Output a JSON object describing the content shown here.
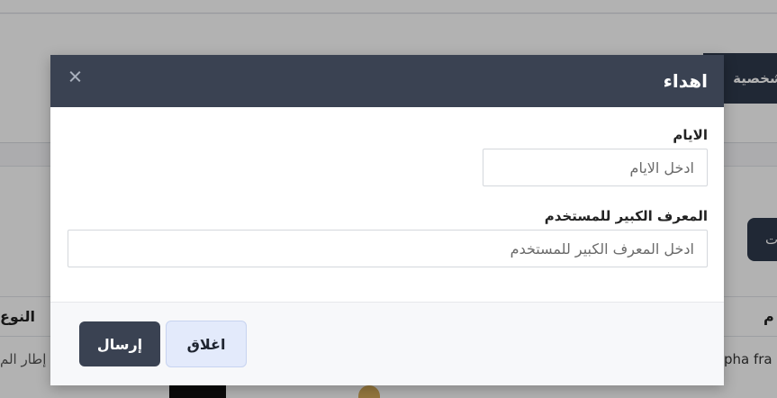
{
  "background": {
    "tab_label": "الشخصية",
    "action_button_label": "ت",
    "table_headers": {
      "name": "م",
      "type": "النوع"
    },
    "table_row": {
      "name": "pha fra",
      "frame": "إطار الم"
    }
  },
  "modal": {
    "title": "اهداء",
    "days": {
      "label": "الايام",
      "placeholder": "ادخل الايام",
      "value": ""
    },
    "uuid": {
      "label": "المعرف الكبير للمستخدم",
      "placeholder": "ادخل المعرف الكبير للمستخدم",
      "value": ""
    },
    "buttons": {
      "submit": "إرسال",
      "close": "اغلاق"
    }
  },
  "colors": {
    "header_bg": "#3a4252",
    "submit_bg": "#3a4252",
    "close_bg": "#e3eafb"
  }
}
